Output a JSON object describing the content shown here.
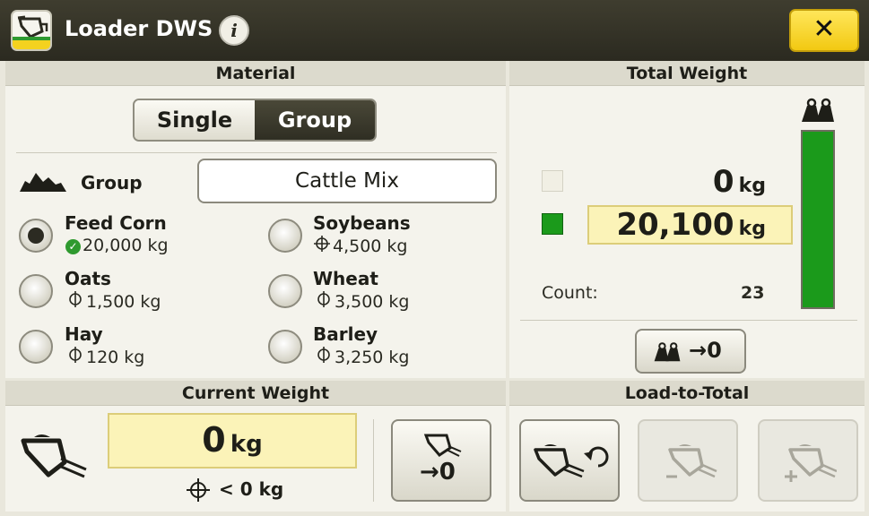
{
  "header": {
    "title": "Loader DWS",
    "info_icon": "i",
    "close_icon": "✕"
  },
  "material": {
    "heading": "Material",
    "mode_options": [
      "Single",
      "Group"
    ],
    "selected_mode": "Group",
    "group_label": "Group",
    "group_value": "Cattle Mix",
    "items": [
      {
        "name": "Feed Corn",
        "weight": "20,000 kg",
        "status": "check",
        "selected": true
      },
      {
        "name": "Soybeans",
        "weight": "4,500 kg",
        "status": "target",
        "selected": false
      },
      {
        "name": "Oats",
        "weight": "1,500 kg",
        "status": "target",
        "selected": false
      },
      {
        "name": "Wheat",
        "weight": "3,500 kg",
        "status": "target",
        "selected": false
      },
      {
        "name": "Hay",
        "weight": "120 kg",
        "status": "target",
        "selected": false
      },
      {
        "name": "Barley",
        "weight": "3,250 kg",
        "status": "target",
        "selected": false
      }
    ]
  },
  "current_weight": {
    "heading": "Current Weight",
    "value": "0",
    "unit": "kg",
    "sub_text": "< 0 kg",
    "zero_button_label": "→0"
  },
  "total_weight": {
    "heading": "Total Weight",
    "value_top": "0",
    "value_main": "20,100",
    "unit": "kg",
    "count_label": "Count:",
    "count_value": "23",
    "reset_button_label": "→0",
    "bar_fill_fraction": 1.0
  },
  "load_to_total": {
    "heading": "Load-to-Total"
  },
  "colors": {
    "accent_yellow": "#f4d21f",
    "bar_green": "#1b9a1b",
    "header_dark": "#2b2a20"
  }
}
